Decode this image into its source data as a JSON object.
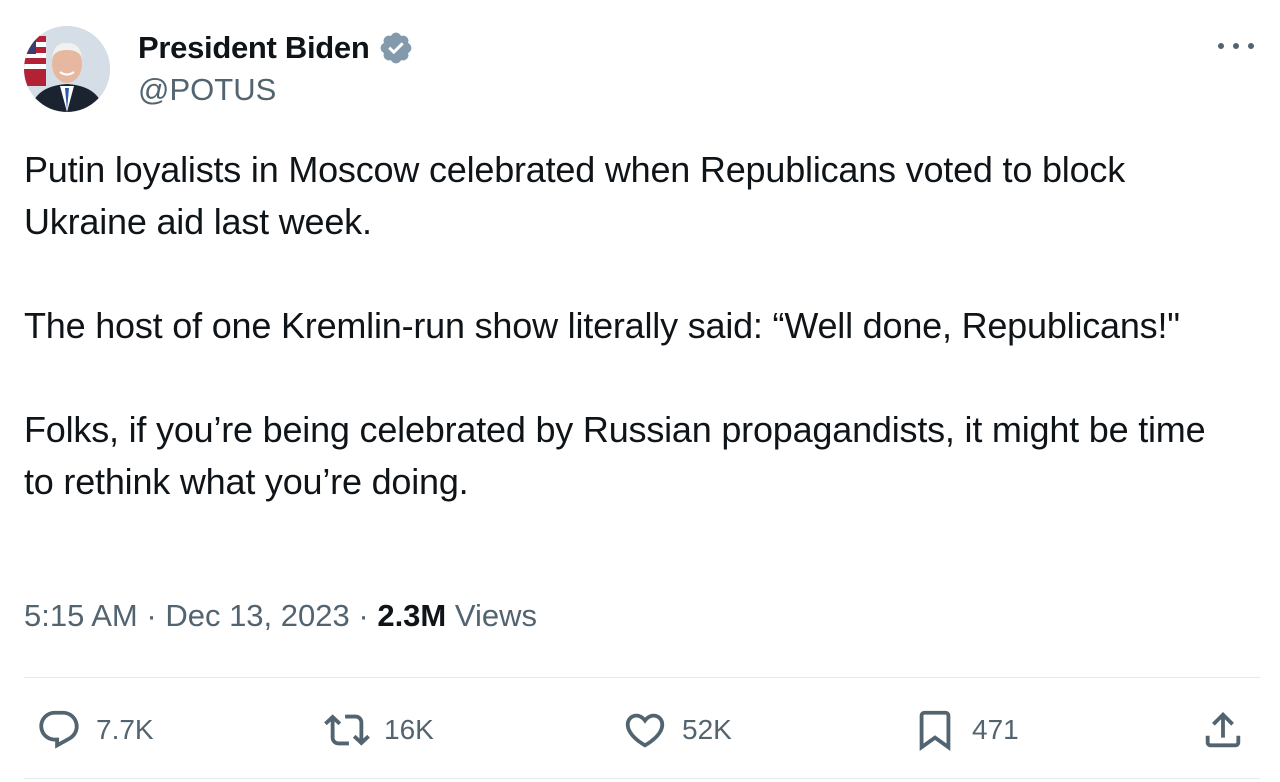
{
  "author": {
    "display_name": "President Biden",
    "handle": "@POTUS",
    "verified": true,
    "verified_color": "#829aab"
  },
  "tweet": {
    "paragraphs": [
      "Putin loyalists in Moscow celebrated when Republicans voted to block Ukraine aid last week.",
      "The host of one Kremlin-run show literally said: “Well done, Republicans!\"",
      "Folks, if you’re being celebrated by Russian propagandists, it might be time to rethink what you’re doing."
    ],
    "time": "5:15 AM",
    "date": "Dec 13, 2023",
    "separator": "·",
    "views_count": "2.3M",
    "views_label": "Views"
  },
  "actions": {
    "reply": {
      "icon": "reply-icon",
      "count": "7.7K"
    },
    "retweet": {
      "icon": "retweet-icon",
      "count": "16K"
    },
    "like": {
      "icon": "heart-icon",
      "count": "52K"
    },
    "bookmark": {
      "icon": "bookmark-icon",
      "count": "471"
    },
    "share": {
      "icon": "share-icon"
    }
  },
  "colors": {
    "text_primary": "#0f1419",
    "text_secondary": "#536471",
    "divider": "#e6e9ec"
  }
}
